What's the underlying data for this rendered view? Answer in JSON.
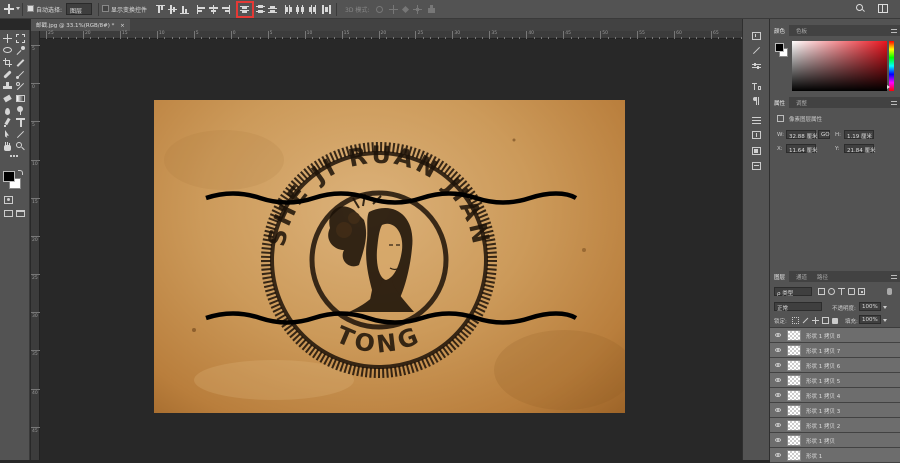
{
  "options_bar": {
    "auto_select_label": "自动选择:",
    "auto_select_value": "图层",
    "show_transform_label": "显示变换控件",
    "mode_label": "3D 模式:"
  },
  "document_tab": {
    "title": "邮戳.jpg @ 33.1%(RGB/8#) *",
    "close": "×"
  },
  "ruler": {
    "h_labels": [
      "25",
      "20",
      "15",
      "10",
      "5",
      "0",
      "5",
      "10",
      "15",
      "20",
      "25",
      "30",
      "35",
      "40",
      "45",
      "50",
      "55",
      "60",
      "65"
    ],
    "v_labels": [
      "5",
      "0",
      "5",
      "10",
      "15",
      "20",
      "25",
      "30",
      "35",
      "40",
      "45"
    ]
  },
  "stamp_text": {
    "top": "SHE JI RUAN JIAN",
    "bottom": "TONG"
  },
  "color_panel": {
    "tabs": [
      "颜色",
      "色板"
    ],
    "active": 0,
    "foreground": "#000000",
    "background": "#ffffff",
    "spectrum_hue": "#e8141e"
  },
  "properties_panel": {
    "tabs": [
      "属性",
      "调整"
    ],
    "active": 0,
    "title": "像素图层属性",
    "w_label": "W:",
    "w_value": "32.88 厘米",
    "link": "GO",
    "h_label": "H:",
    "h_value": "1.19 厘米",
    "x_label": "X:",
    "x_value": "11.64 厘米",
    "y_label": "Y:",
    "y_value": "21.84 厘米"
  },
  "layers_panel": {
    "tabs": [
      "图层",
      "通道",
      "路径"
    ],
    "active": 0,
    "filter_kind": "ρ 类型",
    "blend_mode": "正常",
    "opacity_label": "不透明度:",
    "opacity_value": "100%",
    "lock_label": "锁定:",
    "fill_label": "填充:",
    "fill_value": "100%",
    "layers": [
      {
        "name": "形状 1 拷贝 8",
        "selected": true
      },
      {
        "name": "形状 1 拷贝 7",
        "selected": true
      },
      {
        "name": "形状 1 拷贝 6",
        "selected": true
      },
      {
        "name": "形状 1 拷贝 5",
        "selected": true
      },
      {
        "name": "形状 1 拷贝 4",
        "selected": true
      },
      {
        "name": "形状 1 拷贝 3",
        "selected": true
      },
      {
        "name": "形状 1 拷贝 2",
        "selected": true
      },
      {
        "name": "形状 1 拷贝",
        "selected": true
      },
      {
        "name": "形状 1",
        "selected": true
      }
    ]
  },
  "colors": {
    "highlight": "#e53935",
    "ui_bg": "#535353",
    "canvas_bg": "#282828"
  }
}
